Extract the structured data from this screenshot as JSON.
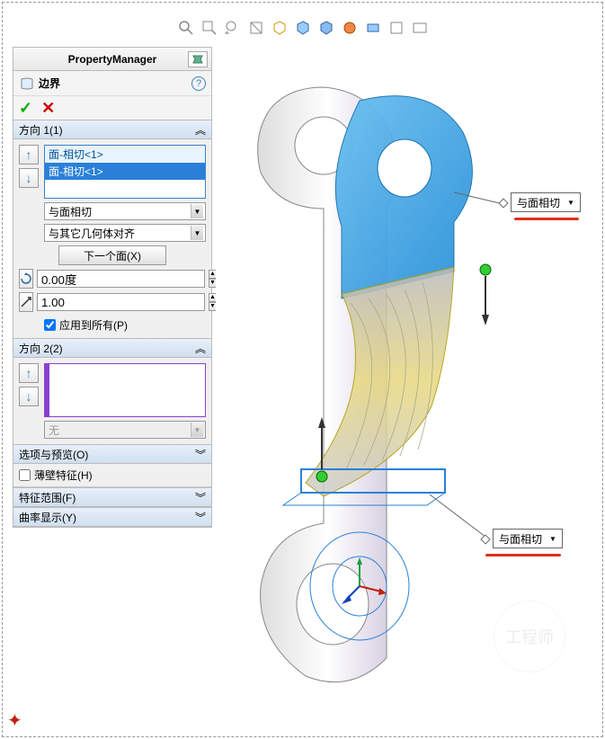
{
  "panel": {
    "title": "PropertyManager",
    "feature_name": "边界",
    "ok_symbol": "✓",
    "cancel_symbol": "✕",
    "help_symbol": "?"
  },
  "direction1": {
    "header": "方向 1(1)",
    "items": [
      "面-相切<1>",
      "面-相切<1>"
    ],
    "tangent_dropdown": "与面相切",
    "align_dropdown": "与其它几何体对齐",
    "next_face_btn": "下一个面(X)",
    "angle_value": "0.00度",
    "scale_value": "1.00",
    "apply_all_label": "应用到所有(P)"
  },
  "direction2": {
    "header": "方向 2(2)",
    "none_dropdown": "无"
  },
  "sections": {
    "options_preview": "选项与预览(O)",
    "thin_feature": "薄壁特征(H)",
    "feature_scope": "特征范围(F)",
    "curvature_display": "曲率显示(Y)"
  },
  "callouts": {
    "top": "与面相切",
    "bottom": "与面相切"
  },
  "watermark": "工程师"
}
